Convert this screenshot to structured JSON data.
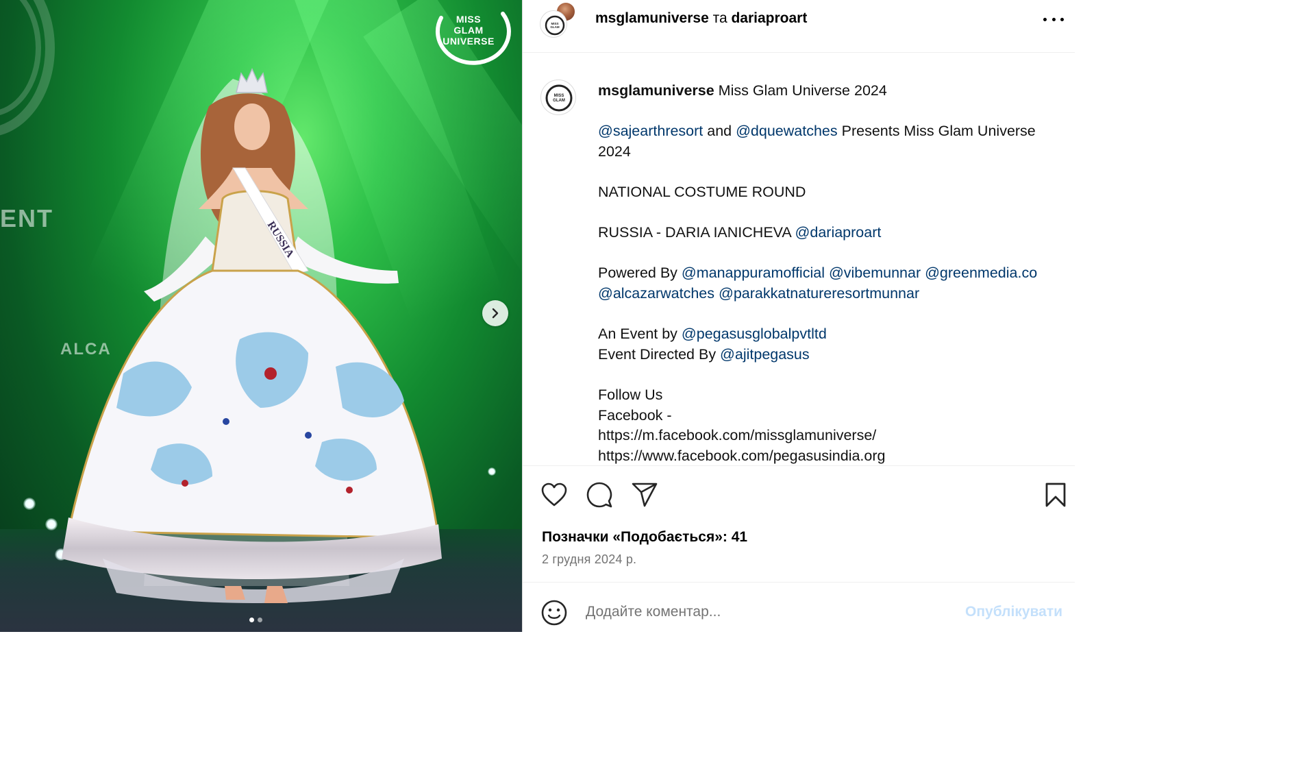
{
  "photo": {
    "logo_lines": [
      "MISS",
      "GLAM",
      "UNIVERSE"
    ],
    "stage_text_ent": "ENT",
    "stage_text_alca": "ALCA",
    "sash_text": "RUSSIA",
    "carousel": {
      "total": 2,
      "active": 0
    }
  },
  "header": {
    "author": "msglamuniverse",
    "conjunction": " та ",
    "collaborator": "dariaproart"
  },
  "caption": {
    "author": "msglamuniverse",
    "title": " Miss Glam Universe 2024",
    "line1_mention_a": "@sajearthresort",
    "line1_and": " and ",
    "line1_mention_b": "@dquewatches",
    "line1_rest": " Presents Miss Glam Universe 2024",
    "round": "NATIONAL COSTUME ROUND",
    "contestant": "RUSSIA - DARIA IANICHEVA ",
    "contestant_mention": "@dariaproart",
    "powered_label": "Powered By ",
    "powered_mentions": [
      "@manappuramofficial",
      "@vibemunnar",
      "@greenmedia.co",
      "@alcazarwatches",
      "@parakkatnatureresortmunnar"
    ],
    "event_label": "An Event by ",
    "event_mention": "@pegasusglobalpvtltd",
    "directed_label": "Event Directed By ",
    "directed_mention": "@ajitpegasus",
    "follow": "Follow Us",
    "facebook": "Facebook -",
    "link1": "https://m.facebook.com/missglamuniverse/",
    "link2": "https://www.facebook.com/pegasusindia.org"
  },
  "actions": {
    "likes_label": "Позначки «Подобається»: 41",
    "date": "2 грудня 2024 р."
  },
  "comment": {
    "placeholder": "Додайте коментар...",
    "publish": "Опублікувати"
  },
  "icons": [
    "more-icon",
    "heart-icon",
    "comment-icon",
    "share-icon",
    "bookmark-icon",
    "emoji-icon",
    "chevron-right-icon"
  ],
  "colors": {
    "mention": "#00376b",
    "muted": "#737373",
    "publish_disabled": "#c4e0fb"
  }
}
